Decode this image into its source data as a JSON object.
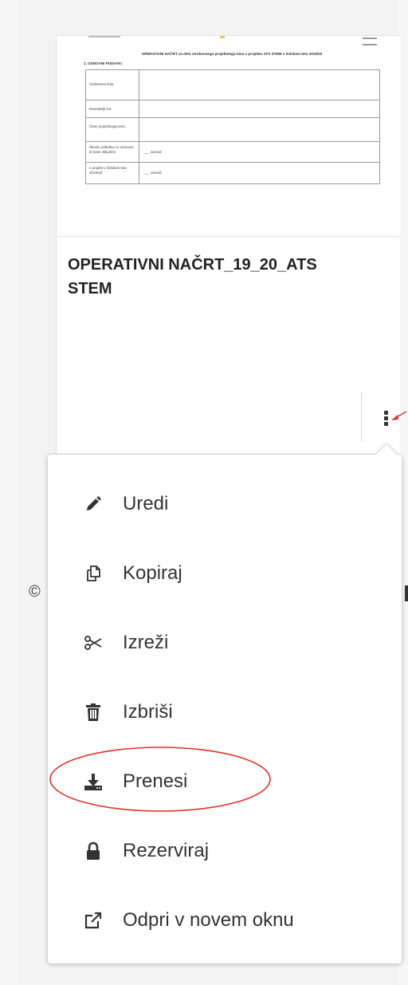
{
  "document": {
    "heading": "OPERATIVNI NAČRT za delo strokovnega projektnega tima v projektu ATS STEM v šolskem letu 2019/20",
    "subheading": "1. OSNOVNI PODATKI",
    "rows": [
      {
        "label": "Vodstvena šola",
        "value": ""
      },
      {
        "label": "Ravnatelj/-ica",
        "value": ""
      },
      {
        "label": "Člani projektnega tima",
        "value": ""
      },
      {
        "label": "Število oddelkov in učencev, ki bodo vključeni",
        "value": "___ razredi"
      },
      {
        "label": "v projekt v šolskem letu 2019/20",
        "value": "___ razredi"
      }
    ]
  },
  "card": {
    "file_name": "OPERATIVNI NAČRT_19_20_ATS STEM"
  },
  "footer": {
    "copyright": "©"
  },
  "menu": {
    "items": [
      {
        "label": "Uredi",
        "icon": "pencil-icon"
      },
      {
        "label": "Kopiraj",
        "icon": "copy-icon"
      },
      {
        "label": "Izreži",
        "icon": "scissors-icon"
      },
      {
        "label": "Izbriši",
        "icon": "trash-icon"
      },
      {
        "label": "Prenesi",
        "icon": "download-icon"
      },
      {
        "label": "Rezerviraj",
        "icon": "lock-icon"
      },
      {
        "label": "Odpri v novem oknu",
        "icon": "external-link-icon"
      }
    ]
  },
  "colors": {
    "annotation_red": "#e0312b",
    "text": "#333333",
    "menu_bg": "#ffffff",
    "page_bg": "#f3f3f3"
  }
}
